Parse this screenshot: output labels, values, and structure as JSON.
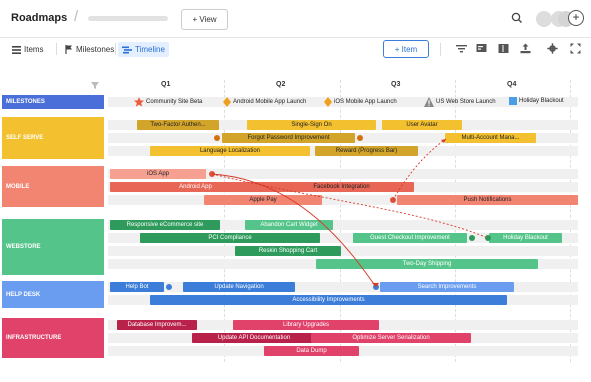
{
  "header": {
    "title": "Roadmaps",
    "separator": "/",
    "view_button": "+ View",
    "plus": "+"
  },
  "toolbar": {
    "items": "Items",
    "milestones": "Milestones",
    "timeline": "Timeline",
    "add_item": "+ Item"
  },
  "quarters": [
    "Q1",
    "Q2",
    "Q3",
    "Q4"
  ],
  "lanes": {
    "milestones": "MILESTONES",
    "self_serve": "SELF SERVE",
    "mobile": "MOBILE",
    "webstore": "WEBSTORE",
    "help_desk": "HELP DESK",
    "infrastructure": "INFRASTRUCTURE"
  },
  "milestones": [
    "Community Site Beta",
    "Android Mobile App Launch",
    "iOS Mobile App Launch",
    "US Web Store Launch",
    "Holiday Blackout"
  ],
  "bars": {
    "ss1": "Two-Factor Authen...",
    "ss2": "Single-Sign On",
    "ss3": "User Avatar",
    "ss4": "Forgot Password Improvement",
    "ss5": "Multi-Account Mana...",
    "ss6": "Language Localization",
    "ss7": "Reward (Progress Bar)",
    "mb1": "iOS App",
    "mb2": "Android App",
    "mb3": "Facebook Integration",
    "mb4": "Apple Pay",
    "mb5": "Push Notifications",
    "ws1": "Responsive eCommerce site",
    "ws2": "Abandon Cart Widget",
    "ws3": "PCI Compliance",
    "ws4": "Guest Checkout Improvement",
    "ws5": "Holiday Blackout",
    "ws6": "Reskin Shopping Cart",
    "ws7": "Two-Day Shipping",
    "hd1": "Help Bot",
    "hd2": "Update Navigation",
    "hd3": "Search Improvements",
    "hd4": "Accessibility Improvements",
    "in1": "Database Improvem...",
    "in2": "Library Upgrades",
    "in3": "Update API Documentation",
    "in4": "Optimize Server Serialization",
    "in5": "Data Dump"
  },
  "colors": {
    "milestones": "#4a6fd8",
    "self_serve": "#f3c030",
    "mobile": "#f28472",
    "webstore": "#55c48a",
    "help_desk": "#6a9df0",
    "infrastructure": "#e0426a"
  }
}
